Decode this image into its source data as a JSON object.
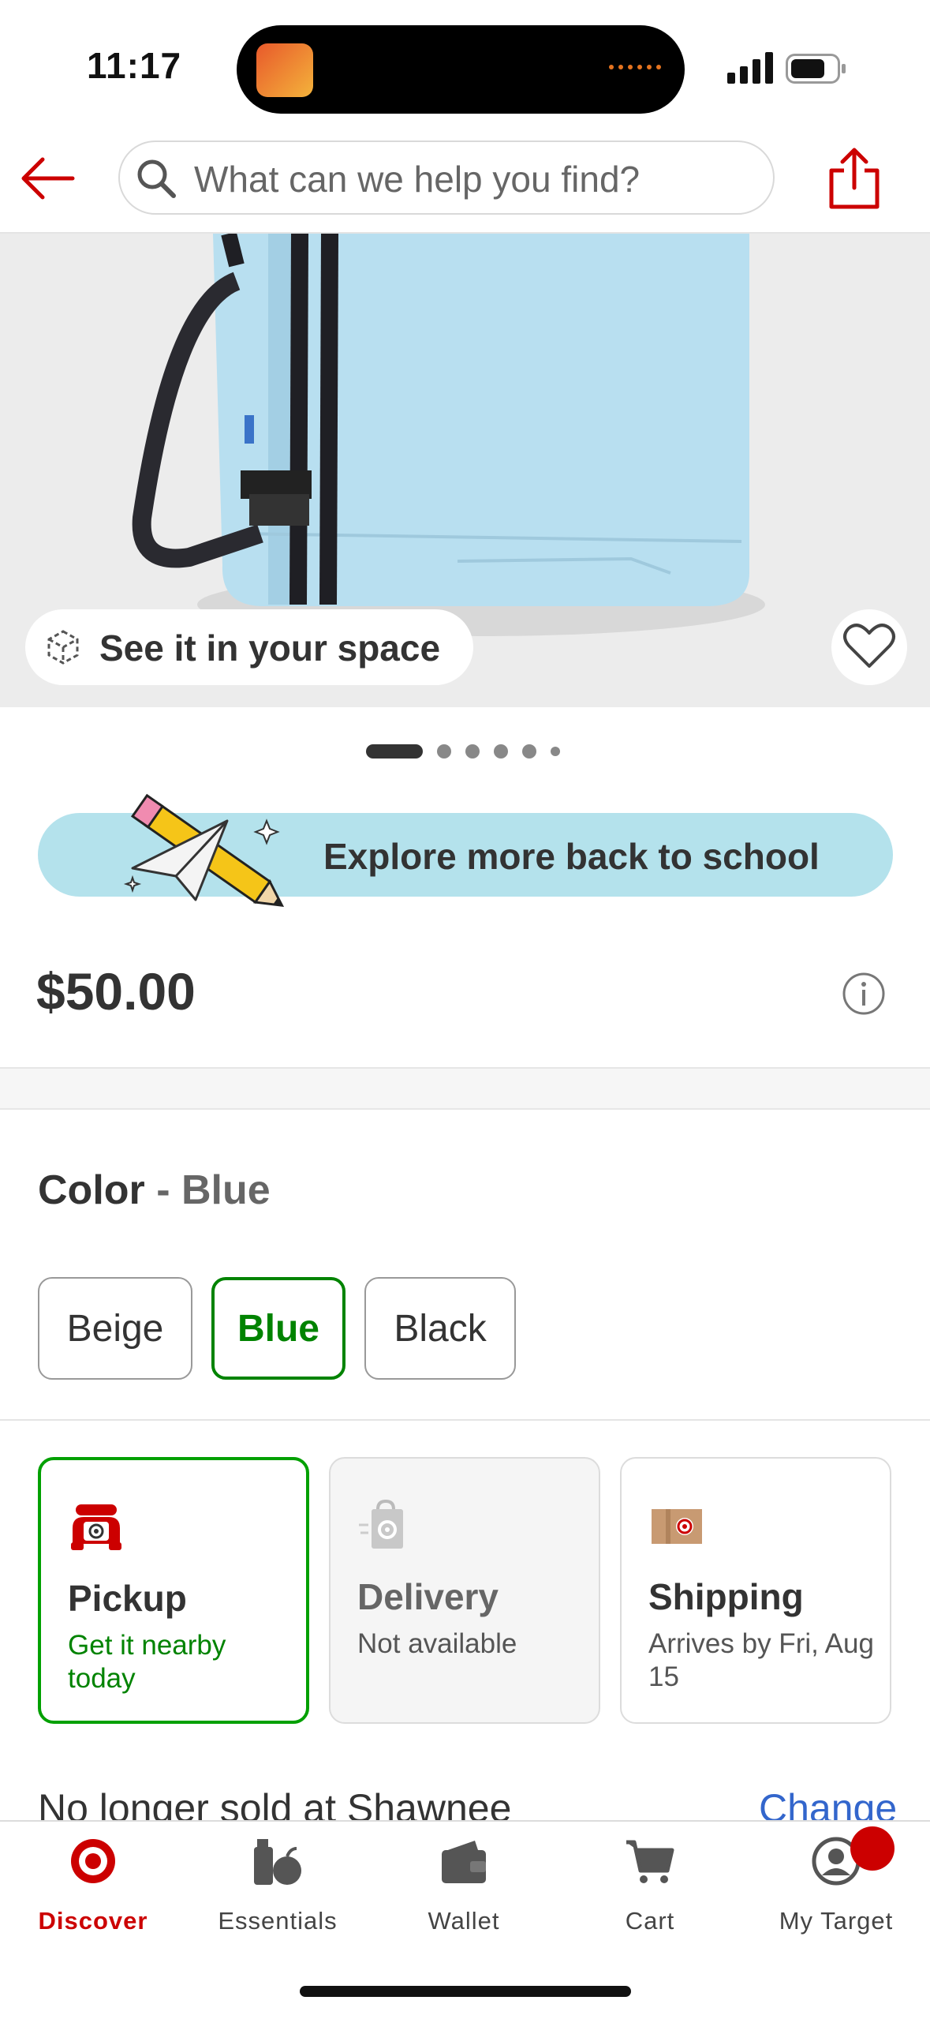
{
  "status_bar": {
    "time": "11:17"
  },
  "header": {
    "search_placeholder": "What can we help you find?"
  },
  "hero": {
    "ar_label": "See it in your space",
    "image_count": 6,
    "active_image": 1
  },
  "promo": {
    "label": "Explore more back to school"
  },
  "product": {
    "price": "$50.00"
  },
  "color": {
    "label": "Color",
    "separator": " - ",
    "selected": "Blue",
    "options": [
      "Beige",
      "Blue",
      "Black"
    ]
  },
  "fulfillment": {
    "pickup": {
      "title": "Pickup",
      "subtitle": "Get it nearby today"
    },
    "delivery": {
      "title": "Delivery",
      "subtitle": "Not available"
    },
    "shipping": {
      "title": "Shipping",
      "subtitle": "Arrives by Fri, Aug 15"
    }
  },
  "store": {
    "message": "No longer sold at Shawnee",
    "change_label": "Change"
  },
  "nav": {
    "items": [
      {
        "label": "Discover",
        "icon": "target-logo-icon"
      },
      {
        "label": "Essentials",
        "icon": "essentials-icon"
      },
      {
        "label": "Wallet",
        "icon": "wallet-icon"
      },
      {
        "label": "Cart",
        "icon": "cart-icon"
      },
      {
        "label": "My Target",
        "icon": "account-icon"
      }
    ]
  },
  "colors": {
    "brand_red": "#cc0000",
    "selected_green": "#008300",
    "promo_bg": "#b4e2ec",
    "link_blue": "#3366cc"
  }
}
